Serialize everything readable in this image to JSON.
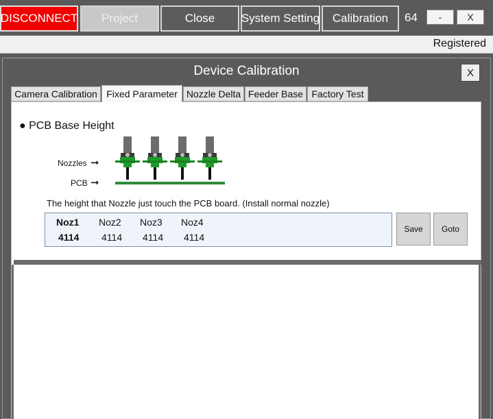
{
  "topbar": {
    "disconnect_label": "DISCONNECT",
    "project_label": "Project",
    "close_label": "Close",
    "system_setting_label": "System Setting",
    "calibration_label": "Calibration",
    "counter": "64",
    "minimize_label": "-",
    "exit_label": "X"
  },
  "status": {
    "registered": "Registered"
  },
  "dialog": {
    "title": "Device Calibration",
    "close_label": "X",
    "tabs": [
      {
        "label": "Camera Calibration"
      },
      {
        "label": "Fixed Parameter"
      },
      {
        "label": "Nozzle Delta"
      },
      {
        "label": "Feeder Base"
      },
      {
        "label": "Factory Test"
      }
    ],
    "active_tab": "Fixed Parameter",
    "section_title": "● PCB Base Height",
    "illustration": {
      "nozzles_label": "Nozzles",
      "pcb_label": "PCB",
      "arrow": "➞"
    },
    "description": "The height that Nozzle just touch the PCB board. (Install normal nozzle)",
    "values": {
      "headers": [
        "Noz1",
        "Noz2",
        "Noz3",
        "Noz4"
      ],
      "cells": [
        "4114",
        "4114",
        "4114",
        "4114"
      ]
    },
    "save_label": "Save",
    "goto_label": "Goto"
  },
  "colors": {
    "disconnect_bg": "#f20000",
    "window_bg": "#5a5a5a",
    "nozzle_green": "#1f9a2a",
    "value_box_bg": "#eef4fa"
  }
}
